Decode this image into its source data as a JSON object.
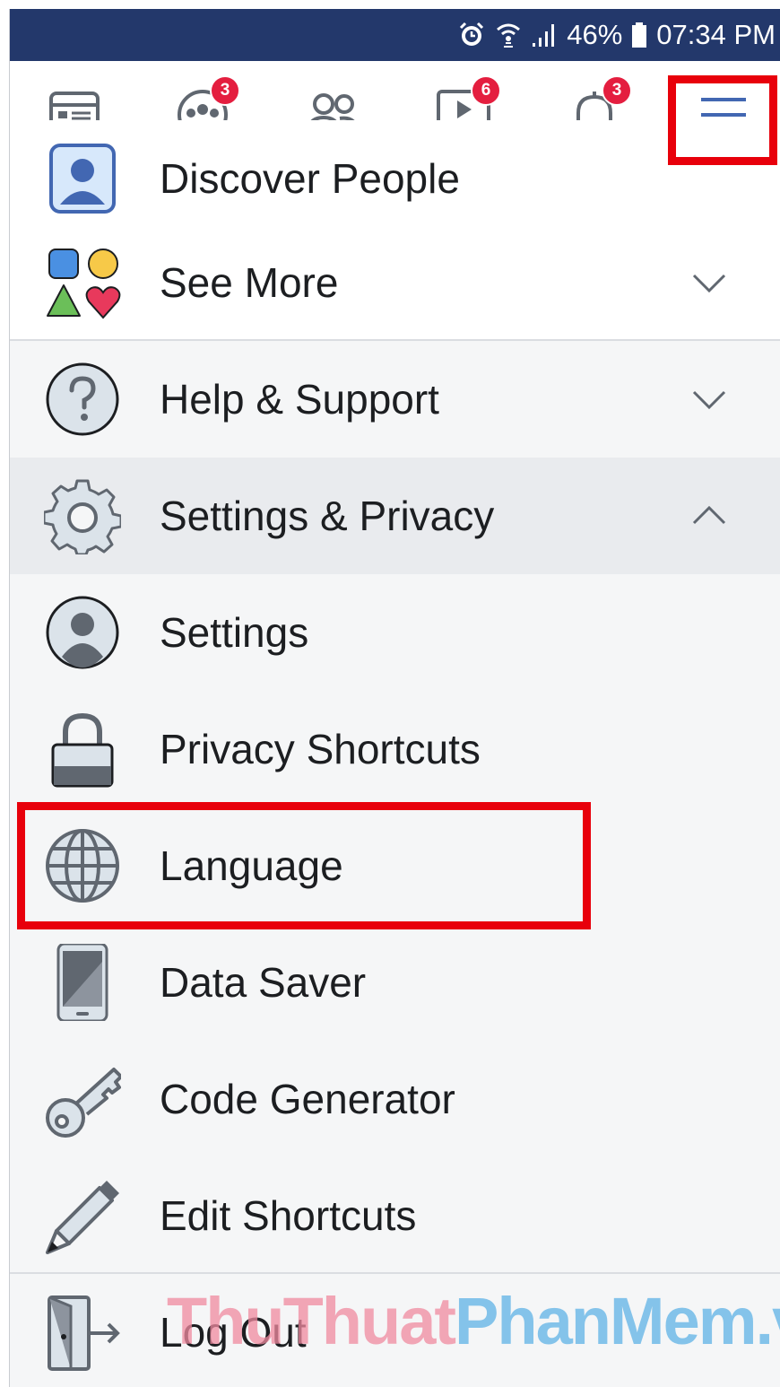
{
  "status_bar": {
    "battery_percent": "46%",
    "time": "07:34 PM",
    "icons": [
      "alarm-icon",
      "wifi-icon",
      "signal-icon",
      "battery-icon"
    ]
  },
  "nav_bar": {
    "tabs": [
      {
        "name": "news-feed",
        "icon": "news-feed-icon",
        "badge": ""
      },
      {
        "name": "groups",
        "icon": "groups-icon",
        "badge": "3"
      },
      {
        "name": "friends",
        "icon": "friends-icon",
        "badge": ""
      },
      {
        "name": "watch",
        "icon": "watch-icon",
        "badge": "6"
      },
      {
        "name": "notifications",
        "icon": "bell-icon",
        "badge": "3"
      },
      {
        "name": "menu",
        "icon": "hamburger-menu-icon",
        "badge": ""
      }
    ]
  },
  "menu": {
    "discover_people": "Discover People",
    "see_more": "See More",
    "help_support": "Help & Support",
    "settings_privacy": "Settings & Privacy",
    "settings": "Settings",
    "privacy_shortcuts": "Privacy Shortcuts",
    "language": "Language",
    "data_saver": "Data Saver",
    "code_generator": "Code Generator",
    "edit_shortcuts": "Edit Shortcuts",
    "log_out": "Log Out"
  },
  "watermark": {
    "part1": "ThuThuat",
    "part2": "PhanMem.vn"
  },
  "colors": {
    "status_bar": "#23386b",
    "accent_blue": "#4267b2",
    "badge_red": "#e41e3f",
    "highlight_red": "#e8000b",
    "text": "#1c1e21",
    "icon_gray": "#606770"
  }
}
